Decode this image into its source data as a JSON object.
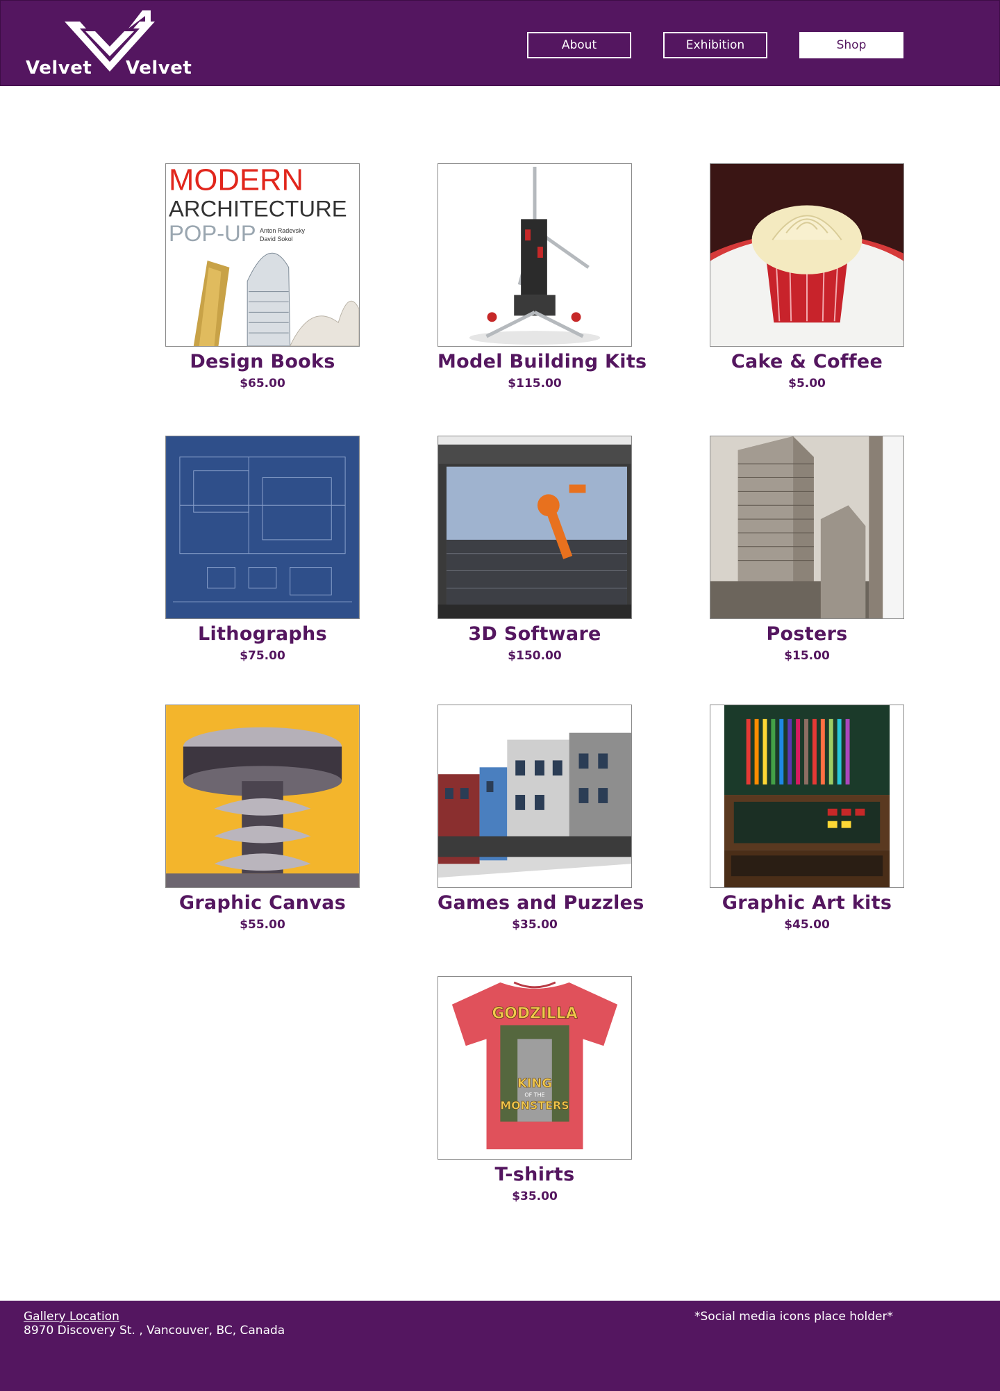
{
  "header": {
    "logo_left": "Velvet",
    "logo_right": "Velvet",
    "nav": [
      {
        "label": "About",
        "active": false
      },
      {
        "label": "Exhibition",
        "active": false
      },
      {
        "label": "Shop",
        "active": true
      }
    ]
  },
  "products": [
    {
      "name": "Design Books",
      "price": "$65.00",
      "book": {
        "title1": "MODERN",
        "title2": "ARCHITECTURE",
        "title3": "POP-UP",
        "author1": "Anton Radevsky",
        "author2": "David Sokol"
      }
    },
    {
      "name": "Model Building Kits",
      "price": "$115.00"
    },
    {
      "name": "Cake & Coffee",
      "price": "$5.00"
    },
    {
      "name": "Lithographs",
      "price": "$75.00"
    },
    {
      "name": "3D Software",
      "price": "$150.00"
    },
    {
      "name": "Posters",
      "price": "$15.00"
    },
    {
      "name": "Graphic Canvas",
      "price": "$55.00"
    },
    {
      "name": "Games and Puzzles",
      "price": "$35.00"
    },
    {
      "name": "Graphic Art kits",
      "price": "$45.00"
    },
    {
      "name": "T-shirts",
      "price": "$35.00",
      "shirt": {
        "line1": "GODZILLA",
        "line2": "KING",
        "line3": "OF THE",
        "line4": "MONSTERS"
      }
    }
  ],
  "footer": {
    "location_link": "Gallery Location",
    "address": "8970 Discovery St. , Vancouver, BC, Canada",
    "social_placeholder": "*Social media icons place holder*"
  },
  "colors": {
    "brand": "#541660",
    "white": "#ffffff"
  }
}
